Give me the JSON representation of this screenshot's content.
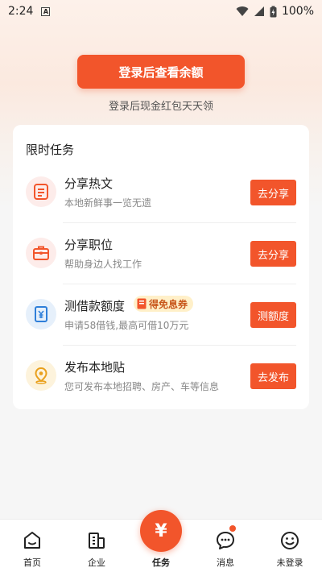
{
  "status_bar": {
    "time": "2:24",
    "notification_badge": "A",
    "battery": "100%"
  },
  "header": {
    "login_button": "登录后查看余额",
    "login_subtitle": "登录后现金红包天天领"
  },
  "tasks": {
    "title": "限时任务",
    "items": [
      {
        "title": "分享热文",
        "desc": "本地新鲜事一览无遗",
        "button": "去分享",
        "icon": "article-icon"
      },
      {
        "title": "分享职位",
        "desc": "帮助身边人找工作",
        "button": "去分享",
        "icon": "briefcase-icon"
      },
      {
        "title": "测借款额度",
        "desc": "申请58借钱,最高可借10万元",
        "button": "测额度",
        "icon": "yuan-card-icon",
        "coupon": "得免息券"
      },
      {
        "title": "发布本地贴",
        "desc": "您可发布本地招聘、房产、车等信息",
        "button": "去发布",
        "icon": "location-pin-icon"
      }
    ]
  },
  "bottom_nav": {
    "items": [
      {
        "label": "首页",
        "icon": "home-icon"
      },
      {
        "label": "企业",
        "icon": "building-icon"
      },
      {
        "label": "任务",
        "icon": "yuan-coin-icon",
        "symbol": "¥"
      },
      {
        "label": "消息",
        "icon": "chat-icon"
      },
      {
        "label": "未登录",
        "icon": "smiley-icon"
      }
    ]
  },
  "colors": {
    "accent": "#f2552b",
    "coupon_bg": "#fff0c9"
  }
}
